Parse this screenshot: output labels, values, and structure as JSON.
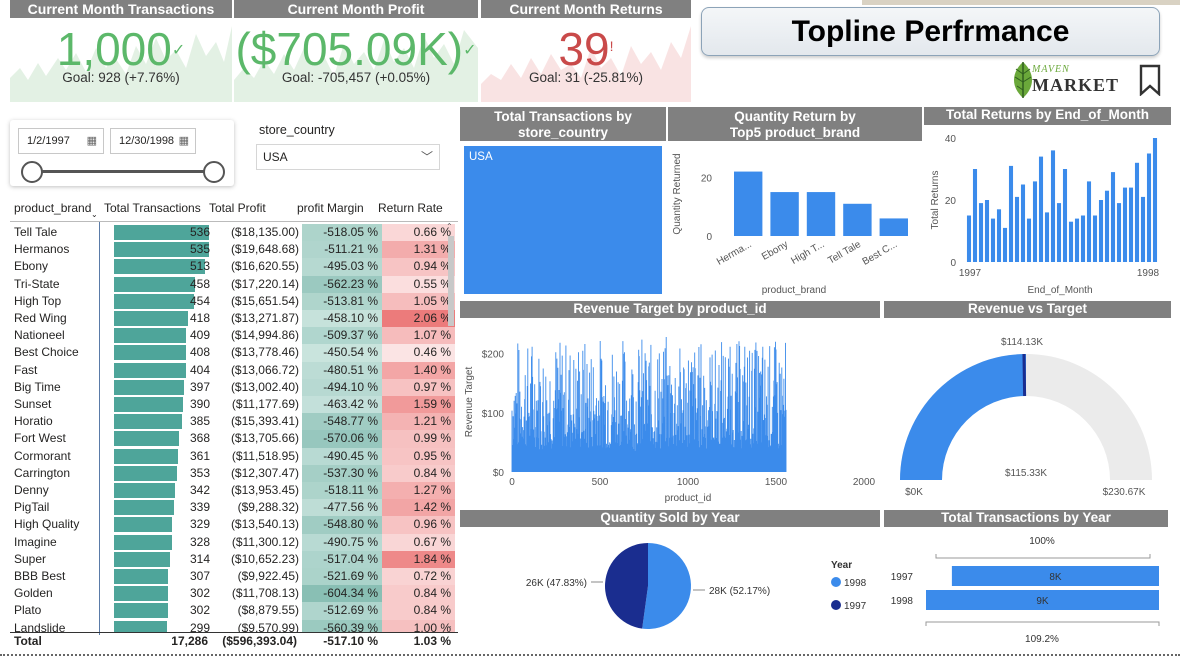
{
  "kpis": {
    "transactions": {
      "title": "Current Month Transactions",
      "value": "1,000",
      "indicator": "✓",
      "goal": "Goal: 928 (+7.76%)",
      "color": "#5cb86a"
    },
    "profit": {
      "title": "Current Month Profit",
      "value": "($705.09K)",
      "indicator": "✓",
      "goal": "Goal: -705,457 (+0.05%)",
      "color": "#5cb86a"
    },
    "returns": {
      "title": "Current Month Returns",
      "value": "39",
      "indicator": "!",
      "goal": "Goal: 31 (-25.81%)",
      "color": "#c94a4a"
    }
  },
  "header": {
    "title": "Topline Perfrmance",
    "logo_line1": "MAVEN",
    "logo_line2": "MARKET"
  },
  "filters": {
    "date_start": "1/2/1997",
    "date_end": "12/30/1998",
    "slider_position": 1.0,
    "country_label": "store_country",
    "country_value": "USA"
  },
  "table": {
    "columns": [
      "product_brand",
      "Total Transactions",
      "Total Profit",
      "profit Margin",
      "Return Rate"
    ],
    "max_transactions": 536,
    "rows": [
      {
        "brand": "Tell Tale",
        "tx": 536,
        "tx_label": "536",
        "profit": "($18,135.00)",
        "margin": "-518.05 %",
        "rr": "0.66 %",
        "rr_v": 0.66,
        "m_v": 518.05
      },
      {
        "brand": "Hermanos",
        "tx": 535,
        "tx_label": "535",
        "profit": "($19,648.68)",
        "margin": "-511.21 %",
        "rr": "1.31 %",
        "rr_v": 1.31,
        "m_v": 511.21
      },
      {
        "brand": "Ebony",
        "tx": 513,
        "tx_label": "513",
        "profit": "($16,620.55)",
        "margin": "-495.03 %",
        "rr": "0.94 %",
        "rr_v": 0.94,
        "m_v": 495.03
      },
      {
        "brand": "Tri-State",
        "tx": 458,
        "tx_label": "458",
        "profit": "($17,220.14)",
        "margin": "-562.23 %",
        "rr": "0.55 %",
        "rr_v": 0.55,
        "m_v": 562.23
      },
      {
        "brand": "High Top",
        "tx": 454,
        "tx_label": "454",
        "profit": "($15,651.54)",
        "margin": "-513.81 %",
        "rr": "1.05 %",
        "rr_v": 1.05,
        "m_v": 513.81
      },
      {
        "brand": "Red Wing",
        "tx": 418,
        "tx_label": "418",
        "profit": "($13,271.87)",
        "margin": "-458.10 %",
        "rr": "2.06 %",
        "rr_v": 2.06,
        "m_v": 458.1
      },
      {
        "brand": "Nationeel",
        "tx": 409,
        "tx_label": "409",
        "profit": "($14,994.86)",
        "margin": "-509.37 %",
        "rr": "1.07 %",
        "rr_v": 1.07,
        "m_v": 509.37
      },
      {
        "brand": "Best Choice",
        "tx": 408,
        "tx_label": "408",
        "profit": "($13,778.46)",
        "margin": "-450.54 %",
        "rr": "0.46 %",
        "rr_v": 0.46,
        "m_v": 450.54
      },
      {
        "brand": "Fast",
        "tx": 404,
        "tx_label": "404",
        "profit": "($13,066.72)",
        "margin": "-480.51 %",
        "rr": "1.40 %",
        "rr_v": 1.4,
        "m_v": 480.51
      },
      {
        "brand": "Big Time",
        "tx": 397,
        "tx_label": "397",
        "profit": "($13,002.40)",
        "margin": "-494.10 %",
        "rr": "0.97 %",
        "rr_v": 0.97,
        "m_v": 494.1
      },
      {
        "brand": "Sunset",
        "tx": 390,
        "tx_label": "390",
        "profit": "($11,177.69)",
        "margin": "-463.42 %",
        "rr": "1.59 %",
        "rr_v": 1.59,
        "m_v": 463.42
      },
      {
        "brand": "Horatio",
        "tx": 385,
        "tx_label": "385",
        "profit": "($15,393.41)",
        "margin": "-548.77 %",
        "rr": "1.21 %",
        "rr_v": 1.21,
        "m_v": 548.77
      },
      {
        "brand": "Fort West",
        "tx": 368,
        "tx_label": "368",
        "profit": "($13,705.66)",
        "margin": "-570.06 %",
        "rr": "0.99 %",
        "rr_v": 0.99,
        "m_v": 570.06
      },
      {
        "brand": "Cormorant",
        "tx": 361,
        "tx_label": "361",
        "profit": "($11,518.95)",
        "margin": "-490.45 %",
        "rr": "0.95 %",
        "rr_v": 0.95,
        "m_v": 490.45
      },
      {
        "brand": "Carrington",
        "tx": 353,
        "tx_label": "353",
        "profit": "($12,307.47)",
        "margin": "-537.30 %",
        "rr": "0.84 %",
        "rr_v": 0.84,
        "m_v": 537.3
      },
      {
        "brand": "Denny",
        "tx": 342,
        "tx_label": "342",
        "profit": "($13,953.45)",
        "margin": "-518.11 %",
        "rr": "1.27 %",
        "rr_v": 1.27,
        "m_v": 518.11
      },
      {
        "brand": "PigTail",
        "tx": 339,
        "tx_label": "339",
        "profit": "($9,288.32)",
        "margin": "-477.56 %",
        "rr": "1.42 %",
        "rr_v": 1.42,
        "m_v": 477.56
      },
      {
        "brand": "High Quality",
        "tx": 329,
        "tx_label": "329",
        "profit": "($13,540.13)",
        "margin": "-548.80 %",
        "rr": "0.96 %",
        "rr_v": 0.96,
        "m_v": 548.8
      },
      {
        "brand": "Imagine",
        "tx": 328,
        "tx_label": "328",
        "profit": "($11,300.12)",
        "margin": "-490.75 %",
        "rr": "0.67 %",
        "rr_v": 0.67,
        "m_v": 490.75
      },
      {
        "brand": "Super",
        "tx": 314,
        "tx_label": "314",
        "profit": "($10,652.23)",
        "margin": "-517.04 %",
        "rr": "1.84 %",
        "rr_v": 1.84,
        "m_v": 517.04
      },
      {
        "brand": "BBB Best",
        "tx": 307,
        "tx_label": "307",
        "profit": "($9,922.45)",
        "margin": "-521.69 %",
        "rr": "0.72 %",
        "rr_v": 0.72,
        "m_v": 521.69
      },
      {
        "brand": "Golden",
        "tx": 302,
        "tx_label": "302",
        "profit": "($11,708.13)",
        "margin": "-604.34 %",
        "rr": "0.84 %",
        "rr_v": 0.84,
        "m_v": 604.34
      },
      {
        "brand": "Plato",
        "tx": 302,
        "tx_label": "302",
        "profit": "($8,879.55)",
        "margin": "-512.69 %",
        "rr": "0.84 %",
        "rr_v": 0.84,
        "m_v": 512.69
      },
      {
        "brand": "Landslide",
        "tx": 299,
        "tx_label": "299",
        "profit": "($9,570.99)",
        "margin": "-560.39 %",
        "rr": "1.00 %",
        "rr_v": 1.0,
        "m_v": 560.39
      }
    ],
    "total": {
      "label": "Total",
      "tx": "17,286",
      "profit": "($596,393.04)",
      "margin": "-517.10 %",
      "rr": "1.03 %"
    }
  },
  "chart_data": [
    {
      "type": "treemap",
      "title": "Total Transactions by store_country",
      "categories": [
        "USA"
      ],
      "values": [
        17286
      ]
    },
    {
      "type": "bar",
      "title": "Quantity Return by Top5 product_brand",
      "xlabel": "product_brand",
      "ylabel": "Quantity Returned",
      "categories": [
        "Herma...",
        "Ebony",
        "High T...",
        "Tell Tale",
        "Best C..."
      ],
      "values": [
        22,
        15,
        15,
        11,
        6
      ],
      "ylim": [
        0,
        28
      ],
      "yticks": [
        "0",
        "20"
      ]
    },
    {
      "type": "bar",
      "title": "Total Returns by End_of_Month",
      "xlabel": "End_of_Month",
      "ylabel": "Total Returns",
      "values": [
        15,
        30,
        19,
        20,
        14,
        17,
        11,
        31,
        21,
        25,
        14,
        26,
        34,
        16,
        36,
        19,
        30,
        13,
        14,
        15,
        26,
        15,
        20,
        23,
        29,
        19,
        24,
        24,
        32,
        21,
        35,
        40
      ],
      "ylim": [
        0,
        40
      ],
      "yticks": [
        "0",
        "20",
        "40"
      ],
      "xticks": [
        "1997",
        "1998"
      ]
    },
    {
      "type": "bar",
      "title": "Revenue Target by product_id",
      "xlabel": "product_id",
      "ylabel": "Revenue Target",
      "n_products": 1560,
      "xlim": [
        0,
        2000
      ],
      "ylim": [
        0,
        240
      ],
      "yticks": [
        "$0",
        "$100",
        "$200"
      ],
      "xticks": [
        "0",
        "500",
        "1000",
        "1500",
        "2000"
      ]
    },
    {
      "type": "gauge",
      "title": "Revenue vs Target",
      "value": 115.33,
      "value_label": "$115.33K",
      "target": 114.13,
      "target_label": "$114.13K",
      "min_label": "$0K",
      "max_label": "$230.67K",
      "min": 0,
      "max": 230.67
    },
    {
      "type": "pie",
      "title": "Quantity Sold by Year",
      "legend_title": "Year",
      "series": [
        {
          "name": "1998",
          "value": 52.17,
          "label": "28K (52.17%)",
          "color": "#3b8beb"
        },
        {
          "name": "1997",
          "value": 47.83,
          "label": "26K (47.83%)",
          "color": "#1a2d8f"
        }
      ]
    },
    {
      "type": "bar",
      "title": "Total Transactions by Year",
      "categories": [
        "1997",
        "1998"
      ],
      "values": [
        8,
        9
      ],
      "value_labels": [
        "8K",
        "9K"
      ],
      "top_label": "100%",
      "bottom_label": "109.2%"
    }
  ],
  "colors": {
    "header_bg": "#808080",
    "teal": "#4ea59a",
    "blue": "#3b8beb",
    "dark_blue": "#1a2d8f",
    "green": "#5cb86a",
    "red": "#c94a4a"
  }
}
